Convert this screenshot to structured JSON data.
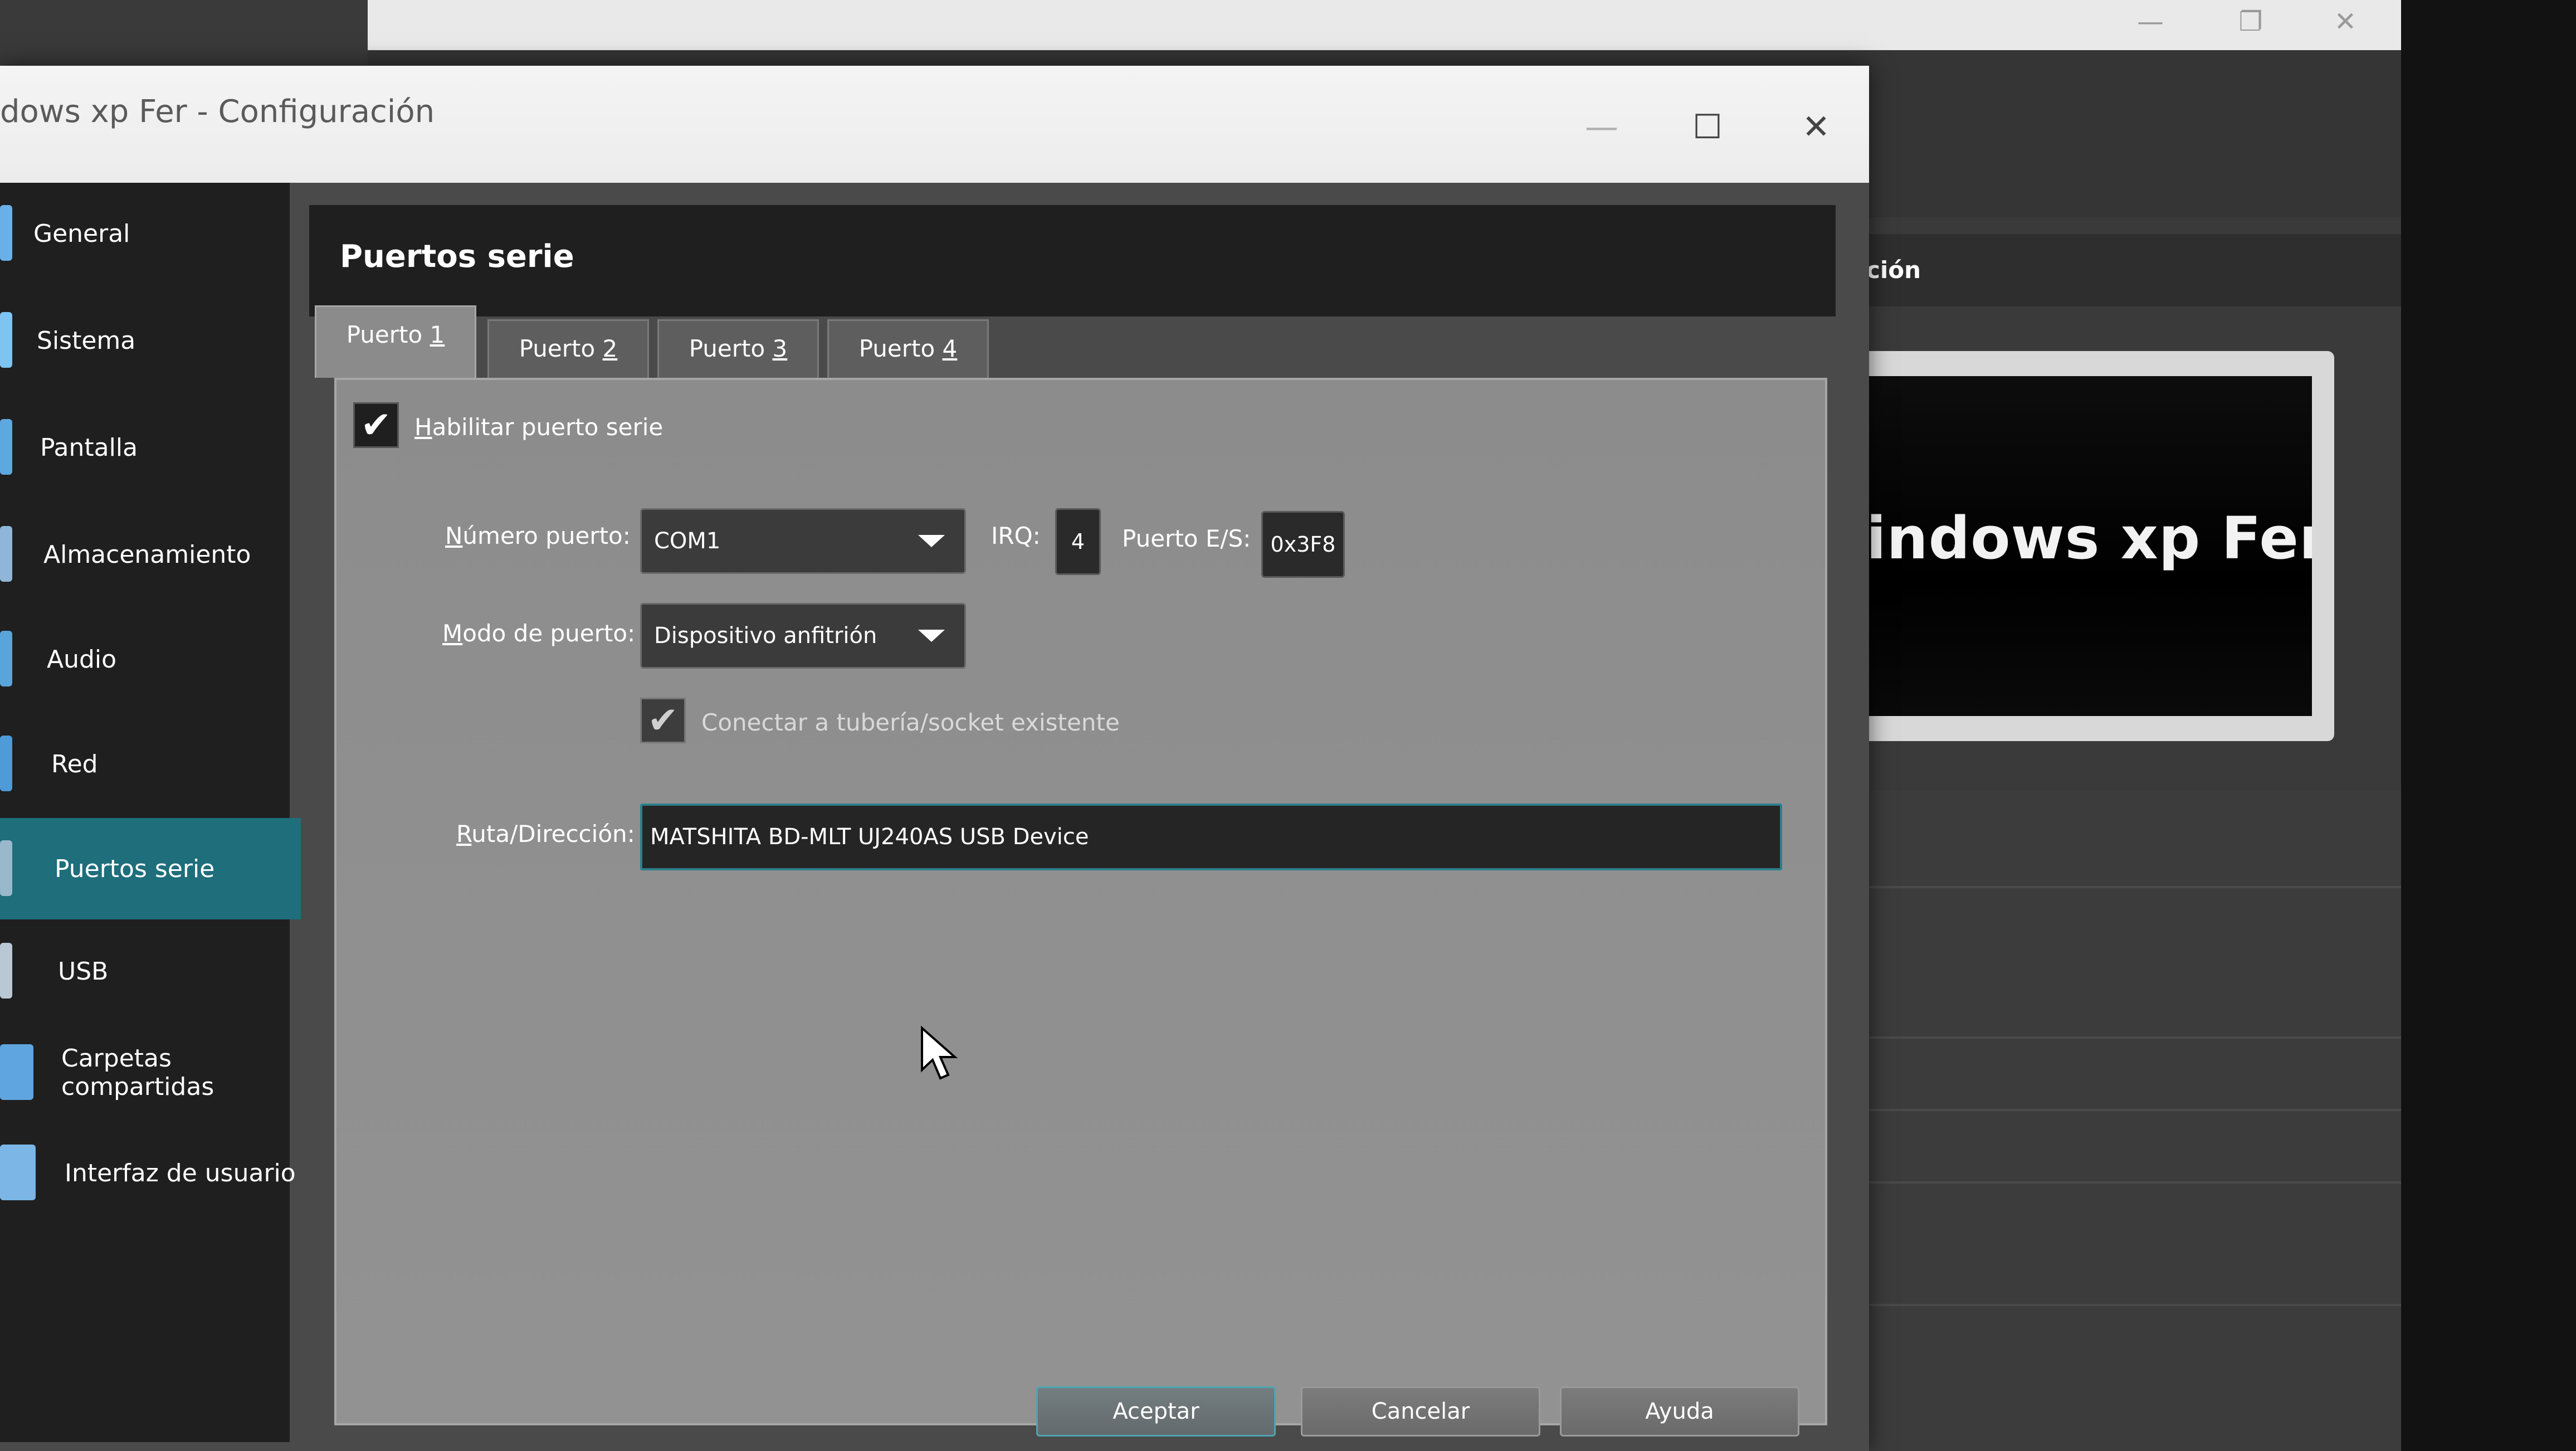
{
  "background_window": {
    "detail_header": "ción",
    "preview_text": "indows xp Fer",
    "window_buttons": [
      "—",
      "❐",
      "✕"
    ]
  },
  "dialog": {
    "title": "dows xp Fer - Configuración",
    "window_buttons": [
      "—",
      "☐",
      "✕"
    ]
  },
  "sidebar": {
    "items": [
      {
        "label": "General",
        "color": "#6ab0e8"
      },
      {
        "label": "Sistema",
        "color": "#7ec4f0"
      },
      {
        "label": "Pantalla",
        "color": "#5ea8e0"
      },
      {
        "label": "Almacenamiento",
        "color": "#8fb6d8"
      },
      {
        "label": "Audio",
        "color": "#5aa4dc"
      },
      {
        "label": "Red",
        "color": "#4f9ad8"
      },
      {
        "label": "Puertos serie",
        "color": "#9ab8cc"
      },
      {
        "label": "USB",
        "color": "#b8c8d4"
      },
      {
        "label": "Carpetas compartidas",
        "color": "#5fa6e0"
      },
      {
        "label": "Interfaz de usuario",
        "color": "#7bb6e6"
      }
    ],
    "selected": "Puertos serie"
  },
  "page": {
    "title": "Puertos serie",
    "tabs": [
      {
        "pre": "Puerto ",
        "key": "1"
      },
      {
        "pre": "Puerto ",
        "key": "2"
      },
      {
        "pre": "Puerto ",
        "key": "3"
      },
      {
        "pre": "Puerto ",
        "key": "4"
      }
    ],
    "active_tab": 0
  },
  "serial": {
    "enable_key": "H",
    "enable_rest": "abilitar puerto serie",
    "enable_checked": true,
    "port_number_key": "N",
    "port_number_rest": "úmero puerto:",
    "port_number_value": "COM1",
    "irq_label": "IRQ:",
    "irq_value": "4",
    "io_label": "Puerto E/S:",
    "io_value": "0x3F8",
    "mode_key": "M",
    "mode_rest": "odo de puerto:",
    "mode_value": "Dispositivo anfitrión",
    "connect_label": "Conectar a tubería/socket existente",
    "connect_checked": true,
    "path_key": "R",
    "path_rest": "uta/Dirección:",
    "path_value": "MATSHITA BD-MLT UJ240AS USB Device"
  },
  "buttons": {
    "ok": "Aceptar",
    "cancel": "Cancelar",
    "help": "Ayuda"
  },
  "colors": {
    "accent": "#1e6e7c",
    "focus_border": "#2b7f8c"
  }
}
